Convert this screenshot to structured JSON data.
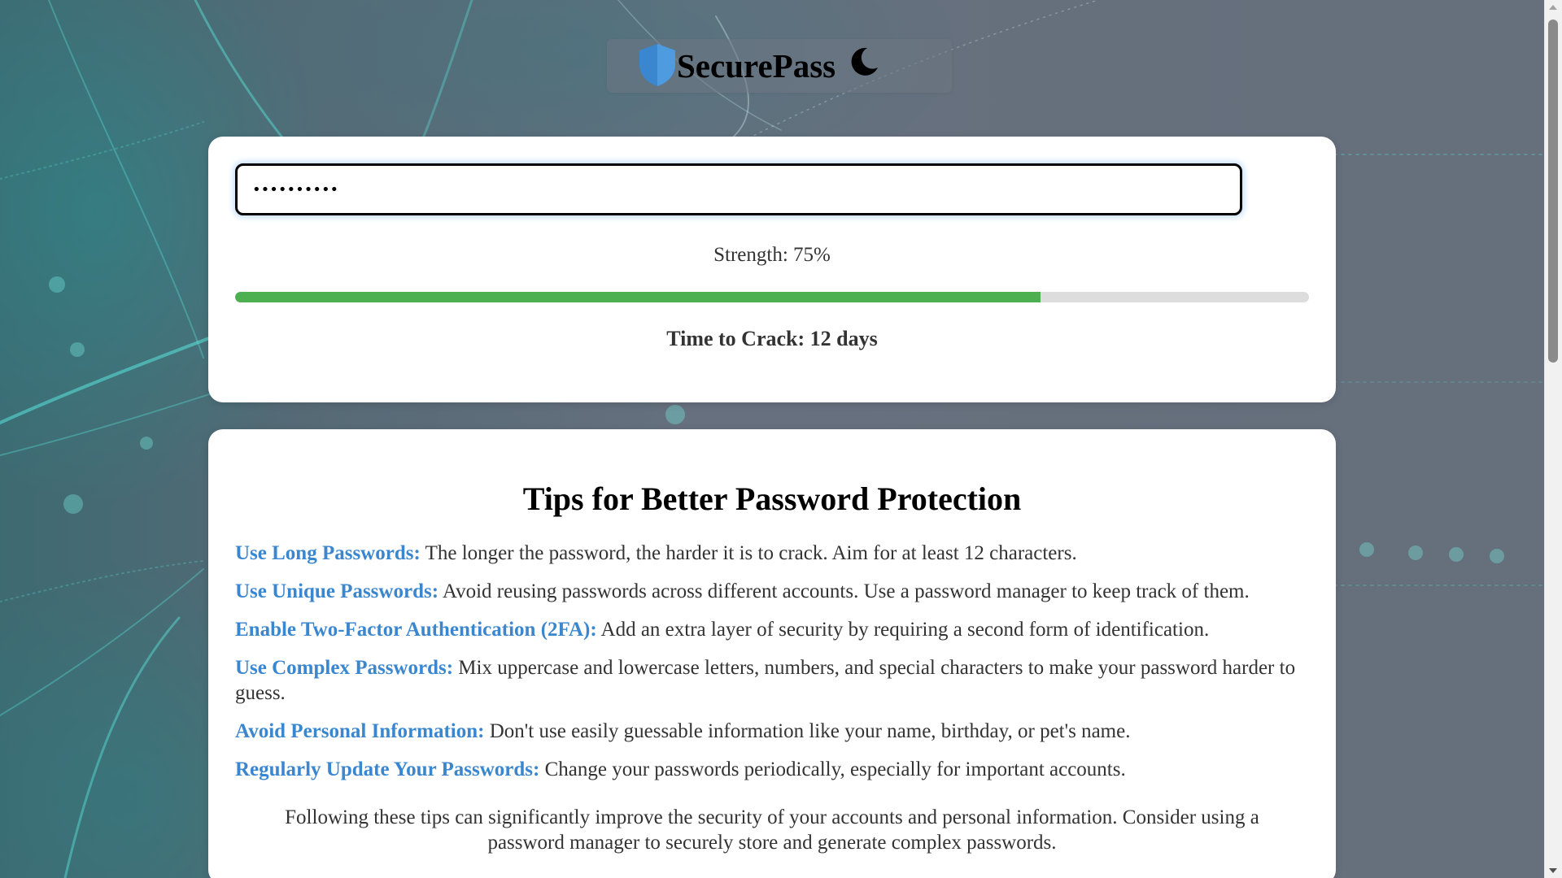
{
  "brand": {
    "name": "SecurePass",
    "logo_icon": "shield-icon",
    "theme_icon": "moon-icon",
    "logo_color": "#3a86cf"
  },
  "password_checker": {
    "input_value": "••••••••••",
    "strength_label": "Strength: 75%",
    "strength_percent": 75,
    "strength_color": "#4caf50",
    "crack_time_label": "Time to Crack: 12 days"
  },
  "tips": {
    "title": "Tips for Better Password Protection",
    "items": [
      {
        "title": "Use Long Passwords:",
        "text": "The longer the password, the harder it is to crack. Aim for at least 12 characters."
      },
      {
        "title": "Use Unique Passwords:",
        "text": "Avoid reusing passwords across different accounts. Use a password manager to keep track of them."
      },
      {
        "title": "Enable Two-Factor Authentication (2FA):",
        "text": "Add an extra layer of security by requiring a second form of identification."
      },
      {
        "title": "Use Complex Passwords:",
        "text": "Mix uppercase and lowercase letters, numbers, and special characters to make your password harder to guess."
      },
      {
        "title": "Avoid Personal Information:",
        "text": "Don't use easily guessable information like your name, birthday, or pet's name."
      },
      {
        "title": "Regularly Update Your Passwords:",
        "text": "Change your passwords periodically, especially for important accounts."
      }
    ],
    "footer": "Following these tips can significantly improve the security of your accounts and personal information. Consider using a password manager to securely store and generate complex passwords."
  },
  "colors": {
    "accent": "#3a86cf",
    "strength_bar": "#4caf50",
    "card_background": "#ffffff"
  }
}
